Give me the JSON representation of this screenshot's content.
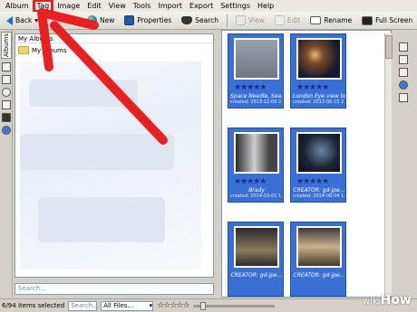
{
  "menu": [
    "Album",
    "Tag",
    "Image",
    "Edit",
    "View",
    "Tools",
    "Import",
    "Export",
    "Settings",
    "Help"
  ],
  "toolbar": {
    "back": "Back",
    "new": "New",
    "properties": "Properties",
    "search": "Search",
    "view": "View",
    "edit": "Edit",
    "rename": "Rename",
    "fullscreen": "Full Screen"
  },
  "sidebar": {
    "tab_label": "Albums"
  },
  "albums": {
    "header": "My Albums",
    "items": [
      {
        "label": "My Albums"
      }
    ]
  },
  "search": {
    "placeholder": "Search..."
  },
  "thumbnails": [
    {
      "title": "Space Needle, Sea...",
      "created": "created: 2013-12-09 2...",
      "modified": "modified: 2014-06-15 ...",
      "stars": "★★★★★"
    },
    {
      "title": "London Eye view to...",
      "created": "created: 2013-09-15 2...",
      "modified": "modified: 2014-06-15 ...",
      "stars": "★★★★★"
    },
    {
      "title": "Brady",
      "created": "created: 2014-03-01 1...",
      "modified": "modified: 2014-06-15 ...",
      "stars": "★★★★★"
    },
    {
      "title": "CREATOR: gd-jpe...",
      "created": "created: 2014-06-04 1...",
      "modified": "modified: 2014-06-15 ...",
      "stars": "★★★★★"
    },
    {
      "title": "CREATOR: gd-jpe...",
      "created": "",
      "modified": "",
      "stars": ""
    },
    {
      "title": "CREATOR: gd-jpe...",
      "created": "",
      "modified": "",
      "stars": ""
    }
  ],
  "status": {
    "selected": "6/94 items selected",
    "search_placeholder": "Search...",
    "filter": "All Files...",
    "rating": "☆☆☆☆☆"
  },
  "watermark": {
    "wiki": "wiki",
    "how": "How"
  },
  "colors": {
    "thumb_bg": "#3a6fd6",
    "highlight": "#e8201f",
    "arrow": "#e8201f"
  }
}
